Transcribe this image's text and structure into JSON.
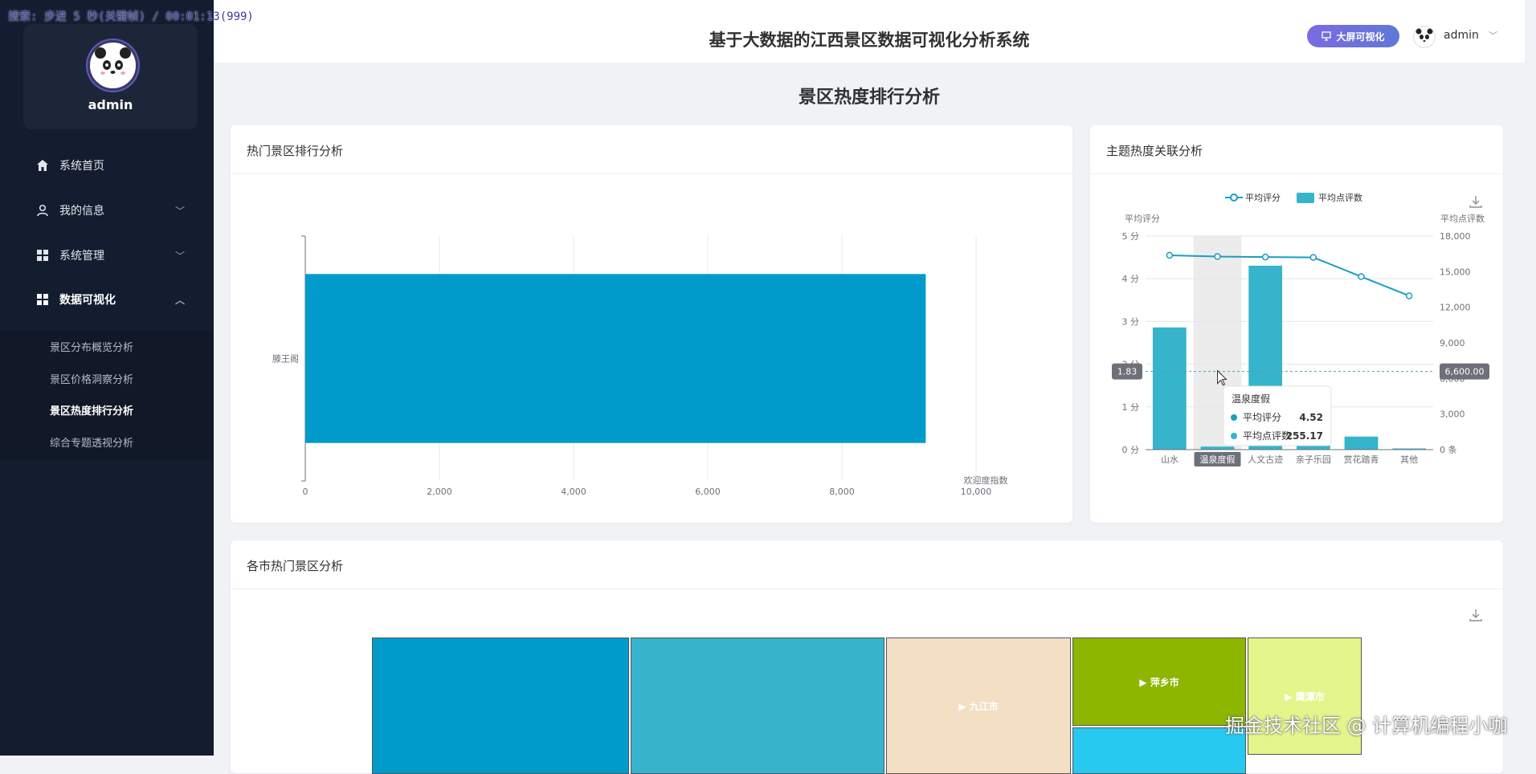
{
  "overlay": {
    "text": "搜索: 步进 5 秒(关键帧) / 00:01:13(999)"
  },
  "profile": {
    "name": "admin"
  },
  "menu": [
    {
      "label": "系统首页",
      "icon": "home-icon",
      "chevron": ""
    },
    {
      "label": "我的信息",
      "icon": "user-icon",
      "chevron": "﹀"
    },
    {
      "label": "系统管理",
      "icon": "grid-icon",
      "chevron": "﹀"
    },
    {
      "label": "数据可视化",
      "icon": "grid-icon",
      "chevron": "︿"
    }
  ],
  "submenu": [
    {
      "label": "景区分布概览分析",
      "active": false
    },
    {
      "label": "景区价格洞察分析",
      "active": false
    },
    {
      "label": "景区热度排行分析",
      "active": true
    },
    {
      "label": "综合专题透视分析",
      "active": false
    }
  ],
  "header": {
    "title": "基于大数据的江西景区数据可视化分析系统",
    "big_screen_button": "大屏可视化",
    "user": "admin"
  },
  "page": {
    "title": "景区热度排行分析"
  },
  "cards": {
    "ranking": {
      "title": "热门景区排行分析"
    },
    "theme": {
      "title": "主题热度关联分析"
    },
    "city": {
      "title": "各市热门景区分析"
    }
  },
  "colors": {
    "accent": "#5f78d8",
    "bar_dark": "#009bcb",
    "bar_light": "#35b4cc",
    "sidebar": "#141d2f"
  },
  "chart_data": [
    {
      "type": "bar",
      "orientation": "horizontal",
      "categories": [
        "滕王阁"
      ],
      "values": [
        9250
      ],
      "xlabel": "欢迎度指数",
      "xlim": [
        0,
        10000
      ],
      "xticks": [
        "0",
        "2,000",
        "4,000",
        "6,000",
        "8,000",
        "10,000"
      ],
      "grid": true
    },
    {
      "type": "bar",
      "categories": [
        "山水",
        "温泉度假",
        "人文古迹",
        "亲子乐园",
        "赏花踏青",
        "其他"
      ],
      "series": [
        {
          "name": "平均评分",
          "type": "line",
          "axis": "left",
          "values": [
            4.55,
            4.52,
            4.51,
            4.5,
            4.05,
            3.6
          ]
        },
        {
          "name": "平均点评数",
          "type": "bar",
          "axis": "right",
          "values": [
            10300,
            255.17,
            15500,
            1400,
            1100,
            100
          ]
        }
      ],
      "y_left": {
        "label": "平均评分",
        "range": [
          0,
          5
        ],
        "ticks": [
          "0 分",
          "1 分",
          "2 分",
          "3 分",
          "4 分",
          "5 分"
        ]
      },
      "y_right": {
        "label": "平均点评数",
        "range": [
          0,
          18000
        ],
        "ticks": [
          "0 条",
          "3,000",
          "6,000",
          "9,000",
          "12,000",
          "15,000",
          "18,000"
        ]
      },
      "highlight_category": "温泉度假",
      "crosshair": {
        "left_label": "1.83",
        "right_label": "6,600.00"
      },
      "tooltip": {
        "title": "温泉度假",
        "rows": [
          {
            "name": "平均评分",
            "value": "4.52"
          },
          {
            "name": "平均点评数",
            "value": "255.17"
          }
        ]
      },
      "legend_position": "top-center"
    },
    {
      "type": "treemap",
      "cells": [
        {
          "label": "",
          "color": "#009bcb"
        },
        {
          "label": "",
          "color": "#35b4cc"
        },
        {
          "label": "▶ 九江市",
          "color": "#f2dfc4"
        },
        {
          "label": "▶ 萍乡市",
          "color": "#8db600"
        },
        {
          "label": "",
          "color": "#27c9f0"
        },
        {
          "label": "▶ 鹰潭市",
          "color": "#e4f58c"
        }
      ]
    }
  ],
  "watermark": {
    "text": "掘金技术社区 @ 计算机编程小咖"
  }
}
